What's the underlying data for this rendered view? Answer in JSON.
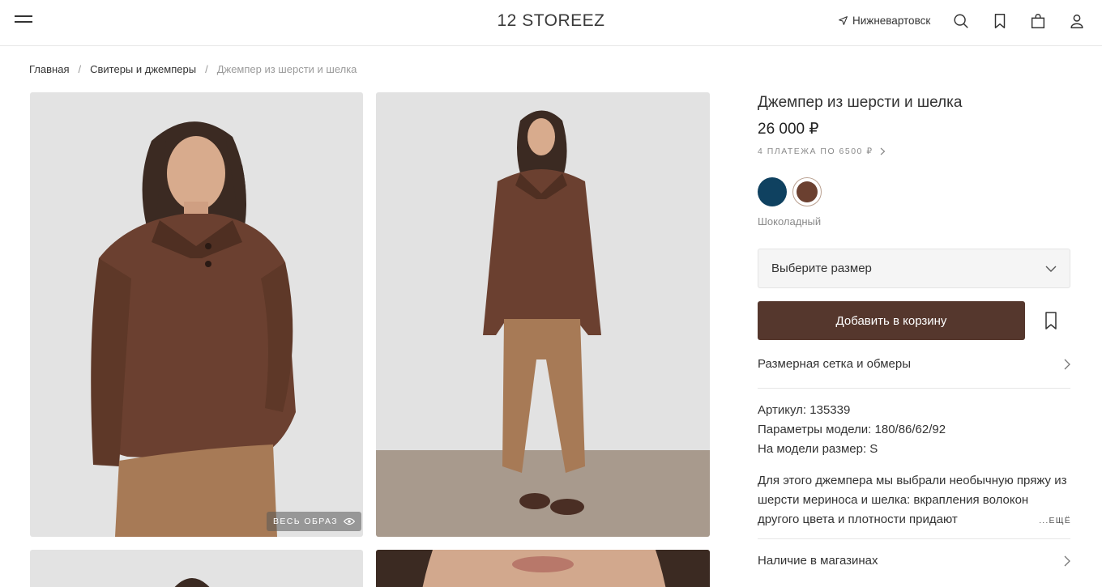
{
  "header": {
    "logo": "12 STOREEZ",
    "city": "Нижневартовск",
    "icons": [
      "menu-icon",
      "location-arrow-icon",
      "search-icon",
      "bookmark-icon",
      "shopping-bag-icon",
      "user-icon"
    ]
  },
  "breadcrumb": {
    "items": [
      "Главная",
      "Свитеры и джемперы"
    ],
    "current": "Джемпер из шерсти и шелка"
  },
  "gallery": {
    "look_badge": "ВЕСЬ ОБРАЗ"
  },
  "product": {
    "title": "Джемпер из шерсти и шелка",
    "price": "26 000 ₽",
    "installments": "4 ПЛАТЕЖА ПО 6500 ₽",
    "colors": [
      {
        "name": "Синий",
        "hex": "#0f4160",
        "selected": false
      },
      {
        "name": "Шоколадный",
        "hex": "#6b4030",
        "selected": true
      }
    ],
    "selected_color": "Шоколадный",
    "size_placeholder": "Выберите размер",
    "add_to_cart": "Добавить в корзину",
    "size_chart": "Размерная сетка и обмеры",
    "article": "Артикул: 135339",
    "model_params": "Параметры модели: 180/86/62/92",
    "model_size": "На модели размер: S",
    "description": "Для этого джемпера мы выбрали необычную пряжу из шерсти мериноса и шелка: вкрапления волокон другого цвета и плотности придают",
    "more": "...ЕЩЁ",
    "availability": "Наличие в магазинах"
  },
  "colors": {
    "button_bg": "#55372d",
    "sweater": "#6b4030",
    "pants": "#a77a56",
    "backdrop": "#e4e4e4"
  }
}
